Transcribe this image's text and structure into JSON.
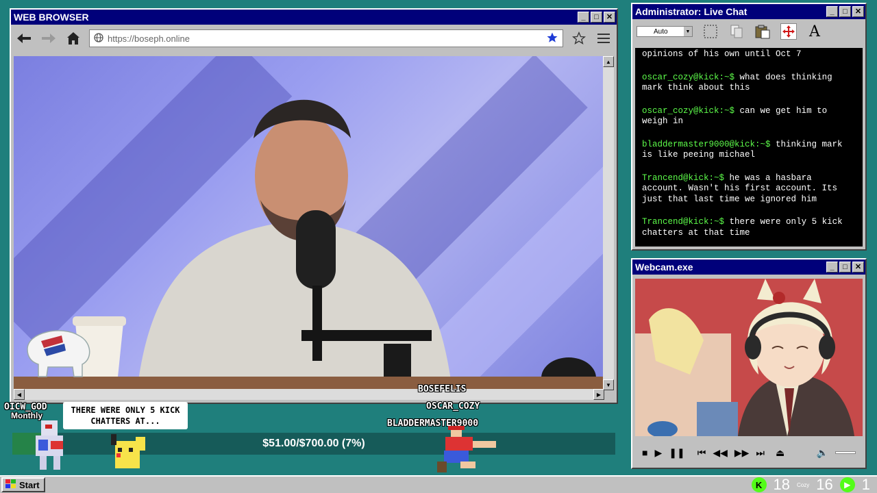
{
  "browser": {
    "title": "WEB BROWSER",
    "url_placeholder": "https://boseph.online"
  },
  "chat": {
    "title": "Administrator: Live Chat",
    "font_size_option": "Auto",
    "messages": [
      {
        "user": "",
        "text": "opinions of his own until Oct 7"
      },
      {
        "user": "oscar_cozy@kick:~$",
        "text": "what does thinking mark think about this"
      },
      {
        "user": "oscar_cozy@kick:~$",
        "text": "can we get him to weigh in"
      },
      {
        "user": "bladdermaster9000@kick:~$",
        "text": "thinking mark is like peeing michael"
      },
      {
        "user": "Trancend@kick:~$",
        "text": "he was a hasbara account. Wasn't his first account. Its just that last time we ignored him"
      },
      {
        "user": "Trancend@kick:~$",
        "text": "there were only 5 kick chatters at that time"
      }
    ]
  },
  "webcam": {
    "title": "Webcam.exe"
  },
  "overlay": {
    "bubble_text": "THERE WERE ONLY 5 KICK CHATTERS AT...",
    "chatters": [
      "BOSEFELIS",
      "OSCAR_COZY",
      "BLADDERMASTER9000",
      "OICW_GOD"
    ],
    "monthly_label": "Monthly",
    "goal_text": "$51.00/$700.00 (7%)",
    "goal_progress": 0.07
  },
  "taskbar": {
    "start_label": "Start",
    "kick_count": "18",
    "cozy_label": "Cozy",
    "viewer_count": "16",
    "other_count": "1"
  },
  "colors": {
    "desktop": "#1f7f7c",
    "titlebar": "#00007a",
    "chat_user": "#5dfc4a",
    "kick_green": "#53fc18"
  }
}
